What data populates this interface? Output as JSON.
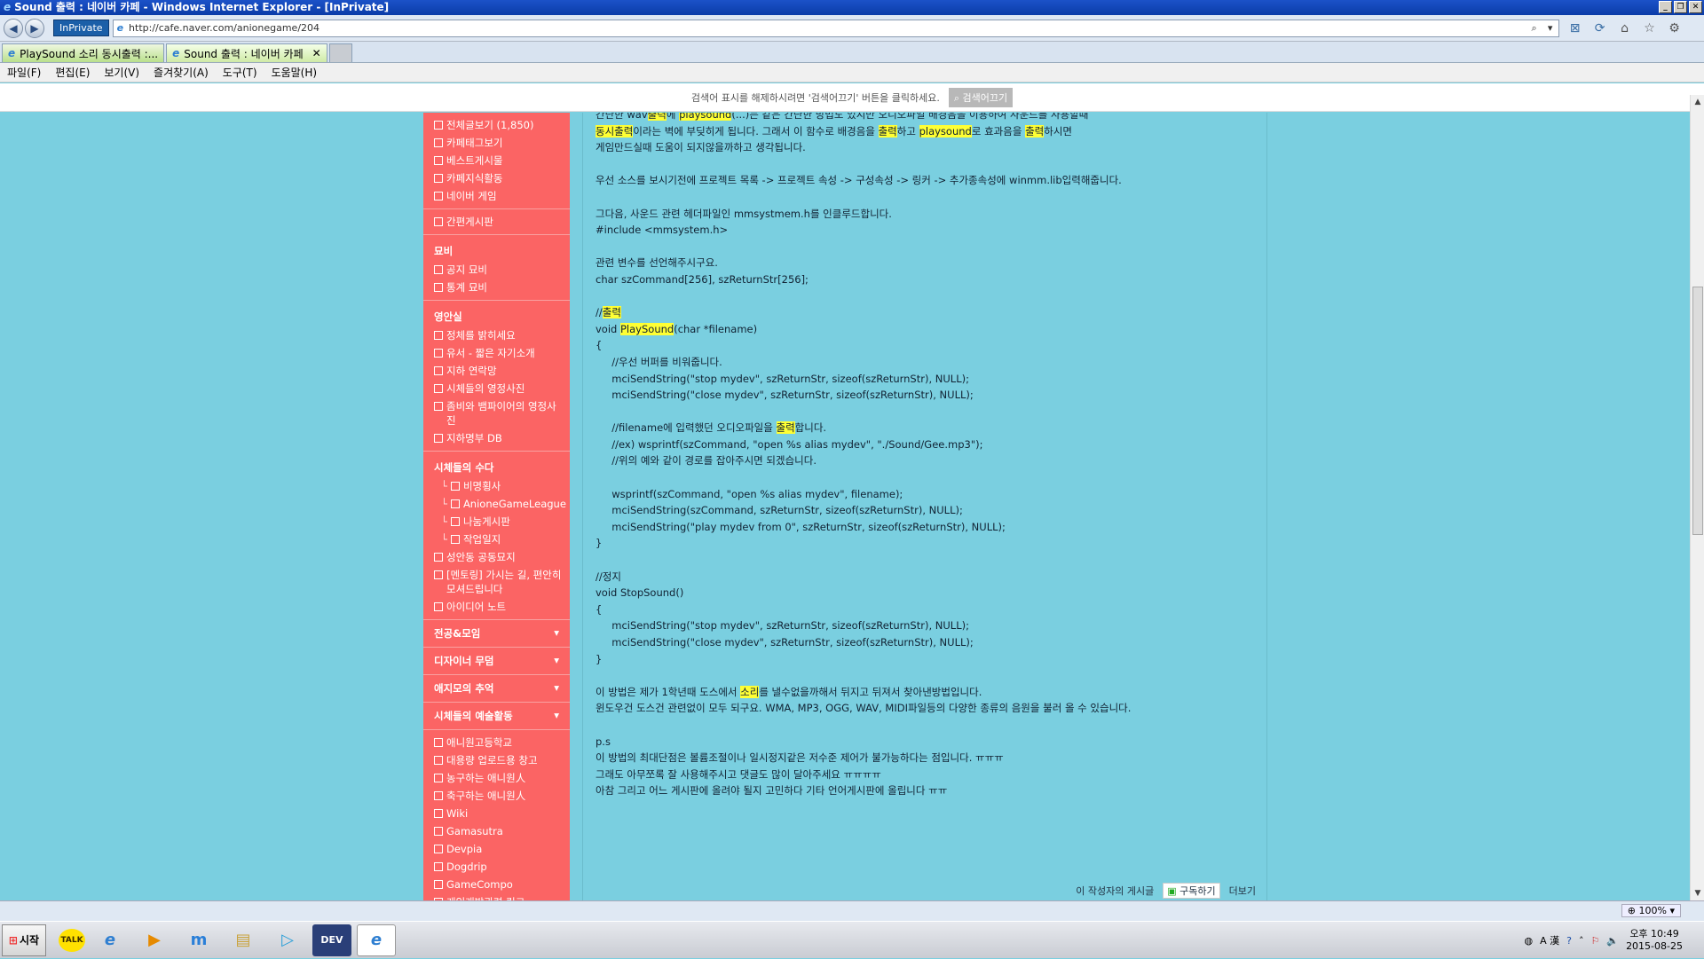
{
  "window": {
    "title": "Sound 출력 : 네이버 카페 - Windows Internet Explorer - [InPrivate]"
  },
  "addressbar": {
    "inprivate_label": "InPrivate",
    "url": "http://cafe.naver.com/anionegame/204"
  },
  "tabs": [
    {
      "label": "PlaySound 소리 동시출력 :..."
    },
    {
      "label": "Sound 출력 : 네이버 카페"
    }
  ],
  "menu": [
    "파일(F)",
    "편집(E)",
    "보기(V)",
    "즐겨찾기(A)",
    "도구(T)",
    "도움말(H)"
  ],
  "search_notice": {
    "text": "검색어 표시를 해제하시려면 '검색어끄기' 버튼을 클릭하세요.",
    "button": "검색어끄기"
  },
  "sidebar": {
    "top_items": [
      {
        "label": "전체글보기 (1,850)"
      },
      {
        "label": "카페태그보기"
      },
      {
        "label": "베스트게시물"
      },
      {
        "label": "카페지식활동"
      },
      {
        "label": "네이버 게임"
      }
    ],
    "simple_board": "간편게시판",
    "groups": [
      {
        "title": "묘비",
        "items": [
          {
            "label": "공지 묘비",
            "indent": false
          },
          {
            "label": "통계 묘비",
            "indent": false
          }
        ]
      },
      {
        "title": "영안실",
        "items": [
          {
            "label": "정체를 밝히세요",
            "indent": false
          },
          {
            "label": "유서 - 짧은 자기소개",
            "indent": false
          },
          {
            "label": "지하 연락망",
            "indent": false
          },
          {
            "label": "시체들의 영정사진",
            "indent": false
          },
          {
            "label": "좀비와 뱀파이어의 영정사진",
            "indent": false
          },
          {
            "label": "지하명부 DB",
            "indent": false
          }
        ]
      },
      {
        "title": "시체들의 수다",
        "items": [
          {
            "label": "비명횡사",
            "indent": true
          },
          {
            "label": "AnioneGameLeague",
            "indent": true
          },
          {
            "label": "나눔게시판",
            "indent": true
          },
          {
            "label": "작업일지",
            "indent": true
          },
          {
            "label": "성안동 공동묘지",
            "indent": false
          },
          {
            "label": "[멘토링] 가시는 길, 편안히 모셔드립니다",
            "indent": false
          },
          {
            "label": "아이디어 노트",
            "indent": false
          }
        ]
      }
    ],
    "folded": [
      "전공&모임",
      "디자이너 무덤",
      "애지모의 추억",
      "시체들의 예술활동"
    ],
    "links": [
      {
        "label": "애니원고등학교"
      },
      {
        "label": "대용량 업로드용 창고"
      },
      {
        "label": "농구하는 애니원人"
      },
      {
        "label": "축구하는 애니원人"
      },
      {
        "label": "Wiki"
      },
      {
        "label": "Gamasutra"
      },
      {
        "label": "Devpia"
      },
      {
        "label": "Dogdrip"
      },
      {
        "label": "GameCompo"
      },
      {
        "label": "게임개발관련 링크"
      }
    ]
  },
  "article": {
    "lines": [
      [
        {
          "t": "간단한 wav"
        },
        {
          "t": "출력",
          "h": true
        },
        {
          "t": "에 "
        },
        {
          "t": "playsound",
          "h": true
        },
        {
          "t": "(...)는 같은 간단한 방법도 있지만 오디오파일 배경음을 이용하여 사운드를 사용할때"
        }
      ],
      [
        {
          "t": "동시출력",
          "h": true
        },
        {
          "t": "이라는 벽에 부딪히게 됩니다. 그래서 이 함수로 배경음을 "
        },
        {
          "t": "출력",
          "h": true
        },
        {
          "t": "하고 "
        },
        {
          "t": "playsound",
          "h": true
        },
        {
          "t": "로 효과음을 "
        },
        {
          "t": "출력",
          "h": true
        },
        {
          "t": "하시면"
        }
      ],
      [
        {
          "t": "게임만드실때 도움이 되지않을까하고 생각됩니다."
        }
      ],
      [
        {
          "t": ""
        }
      ],
      [
        {
          "t": "우선 소스를 보시기전에 프로젝트 목록 -> 프로젝트 속성 -> 구성속성 -> 링커 -> 추가종속성에 winmm.lib입력해줍니다."
        }
      ],
      [
        {
          "t": ""
        }
      ],
      [
        {
          "t": "그다음, 사운드 관련 헤더파일인 mmsystmem.h를 인클루드합니다."
        }
      ],
      [
        {
          "t": "#include <mmsystem.h>"
        }
      ],
      [
        {
          "t": ""
        }
      ],
      [
        {
          "t": "관련 변수를 선언해주시구요."
        }
      ],
      [
        {
          "t": "char szCommand[256], szReturnStr[256];"
        }
      ],
      [
        {
          "t": ""
        }
      ],
      [
        {
          "t": "//"
        },
        {
          "t": "출력",
          "h": true
        }
      ],
      [
        {
          "t": "void "
        },
        {
          "t": "PlaySound",
          "h": true
        },
        {
          "t": "(char *filename)"
        }
      ],
      [
        {
          "t": "{"
        }
      ],
      [
        {
          "t": "     //우선 버퍼를 비워줍니다."
        }
      ],
      [
        {
          "t": "     mciSendString(\"stop mydev\", szReturnStr, sizeof(szReturnStr), NULL);"
        }
      ],
      [
        {
          "t": "     mciSendString(\"close mydev\", szReturnStr, sizeof(szReturnStr), NULL);"
        }
      ],
      [
        {
          "t": ""
        }
      ],
      [
        {
          "t": "     //filename에 입력했던 오디오파일을 "
        },
        {
          "t": "출력",
          "h": true
        },
        {
          "t": "합니다."
        }
      ],
      [
        {
          "t": "     //ex) wsprintf(szCommand, \"open %s alias mydev\", \"./Sound/Gee.mp3\");"
        }
      ],
      [
        {
          "t": "     //위의 예와 같이 경로를 잡아주시면 되겠습니다."
        }
      ],
      [
        {
          "t": ""
        }
      ],
      [
        {
          "t": "     wsprintf(szCommand, \"open %s alias mydev\", filename);"
        }
      ],
      [
        {
          "t": "     mciSendString(szCommand, szReturnStr, sizeof(szReturnStr), NULL);"
        }
      ],
      [
        {
          "t": "     mciSendString(\"play mydev from 0\", szReturnStr, sizeof(szReturnStr), NULL);"
        }
      ],
      [
        {
          "t": "}"
        }
      ],
      [
        {
          "t": ""
        }
      ],
      [
        {
          "t": "//정지"
        }
      ],
      [
        {
          "t": "void StopSound()"
        }
      ],
      [
        {
          "t": "{"
        }
      ],
      [
        {
          "t": "     mciSendString(\"stop mydev\", szReturnStr, sizeof(szReturnStr), NULL);"
        }
      ],
      [
        {
          "t": "     mciSendString(\"close mydev\", szReturnStr, sizeof(szReturnStr), NULL);"
        }
      ],
      [
        {
          "t": "}"
        }
      ],
      [
        {
          "t": ""
        }
      ],
      [
        {
          "t": "이 방법은 제가 1학년때 도스에서 "
        },
        {
          "t": "소리",
          "h": true
        },
        {
          "t": "를 낼수없을까해서 뒤지고 뒤져서 찾아낸방법입니다."
        }
      ],
      [
        {
          "t": "윈도우건 도스건 관련없이 모두 되구요. WMA, MP3, OGG, WAV, MIDI파일등의 다양한 종류의 음원을 불러 올 수 있습니다."
        }
      ],
      [
        {
          "t": ""
        }
      ],
      [
        {
          "t": "p.s"
        }
      ],
      [
        {
          "t": "이 방법의 최대단점은 볼륨조절이나 일시정지같은 저수준 제어가 불가능하다는 점입니다. ㅠㅠㅠ"
        }
      ],
      [
        {
          "t": "그래도 아무쪼록 잘 사용해주시고 댓글도 많이 달아주세요 ㅠㅠㅠㅠ"
        }
      ],
      [
        {
          "t": "아참 그리고 어느 게시판에 올려야 될지 고민하다 기타 언어게시판에 올립니다 ㅠㅠ"
        }
      ]
    ],
    "footer": {
      "author_posts": "이 작성자의 게시글",
      "subscribe": "구독하기",
      "more": "더보기"
    }
  },
  "statusbar": {
    "zoom": "100%"
  },
  "taskbar": {
    "start": "시작",
    "apps": [
      "talk",
      "ie",
      "player",
      "m",
      "folder",
      "live",
      "dev",
      "ie-active"
    ],
    "clock_time": "오후 10:49",
    "clock_date": "2015-08-25"
  }
}
